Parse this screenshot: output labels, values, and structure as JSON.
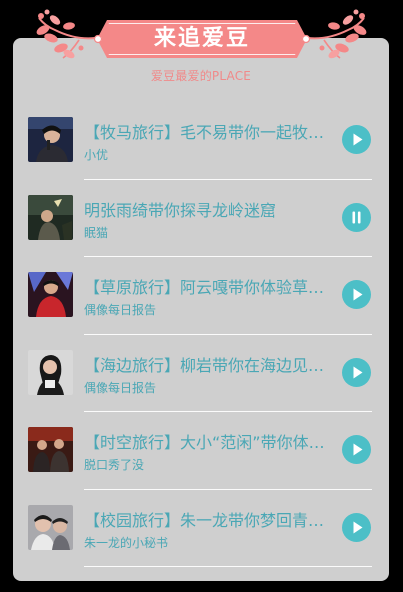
{
  "header": {
    "title": "来追爱豆",
    "subtitle": "爱豆最爱的PLACE"
  },
  "colors": {
    "accent": "#4cbfc7",
    "text": "#4aa7b5",
    "banner": "#f48888",
    "card": "#cfcfcf"
  },
  "items": [
    {
      "title": "【牧马旅行】毛不易带你一起牧马去",
      "author": "小优",
      "state": "play",
      "icon": "play-icon"
    },
    {
      "title": "明张雨绮带你探寻龙岭迷窟",
      "author": "眠猫",
      "state": "pause",
      "icon": "pause-icon"
    },
    {
      "title": "【草原旅行】阿云嘎带你体验草原风情",
      "author": "偶像每日报告",
      "state": "play",
      "icon": "play-icon"
    },
    {
      "title": "【海边旅行】柳岩带你在海边见证浪漫",
      "author": "偶像每日报告",
      "state": "play",
      "icon": "play-icon"
    },
    {
      "title": "【时空旅行】大小“范闲”带你体验时空穿越",
      "author": "脱口秀了没",
      "state": "play",
      "icon": "play-icon"
    },
    {
      "title": "【校园旅行】朱一龙带你梦回青春校园",
      "author": "朱一龙的小秘书",
      "state": "play",
      "icon": "play-icon"
    }
  ]
}
